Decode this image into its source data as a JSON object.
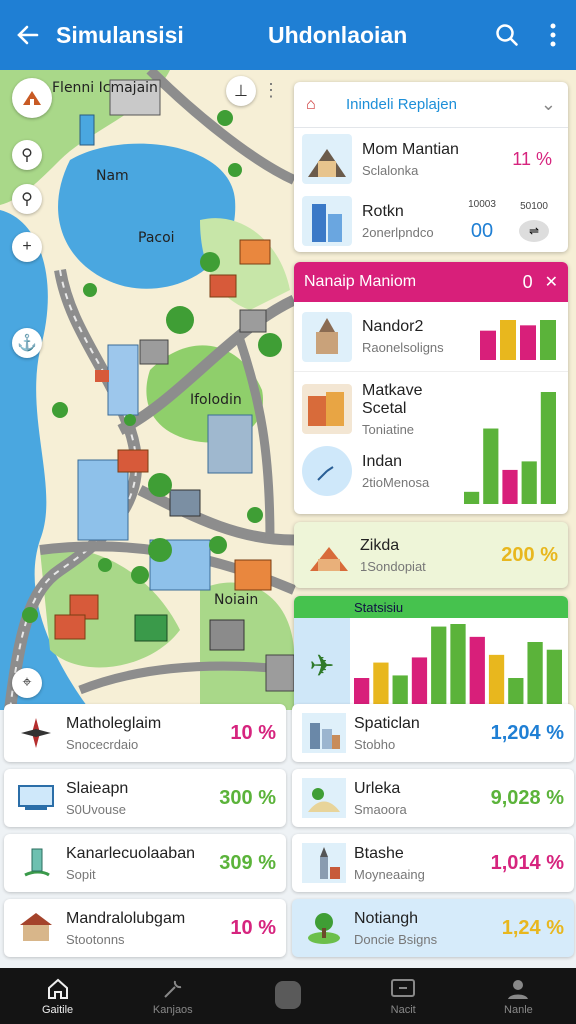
{
  "topbar": {
    "back_icon": "arrow-left-icon",
    "title_left": "Simulansisi",
    "title_center": "Uhdonlaoian",
    "search_icon": "search-icon",
    "more_icon": "more-vertical-icon"
  },
  "map": {
    "labels": {
      "top_left": "Flenni Icmajain",
      "lake_1": "Nam",
      "lake_2": "Pacoi",
      "park": "Ifolodin",
      "district": "Noiain"
    }
  },
  "panel": {
    "header_label": "Inindeli Replajen",
    "rows": [
      {
        "title": "Mom Mantian",
        "subtitle": "Sclalonka",
        "value": "11 %"
      },
      {
        "title": "Rotkn",
        "subtitle": "2onerlpndco",
        "col1": "10003",
        "col2": "50100",
        "value": "00"
      }
    ],
    "magenta_title": "Nanaip Maniom",
    "magenta_value": "0",
    "magenta_rows": [
      {
        "title": "Nandor2",
        "subtitle": "Raonelsoligns"
      },
      {
        "title": "Matkave Scetal",
        "subtitle": "Toniatine"
      },
      {
        "title": "Indan",
        "subtitle": "2tioMenosa"
      }
    ],
    "zikda": {
      "title": "Zikda",
      "subtitle": "1Sondopiat",
      "value": "200 %"
    },
    "stats_title": "Statsisiu",
    "chart1": [
      22,
      30,
      26,
      30
    ],
    "chart2": [
      10,
      62,
      28,
      35,
      92
    ],
    "chart3": [
      28,
      40,
      30,
      44,
      68,
      70,
      60,
      46,
      28,
      56,
      50
    ]
  },
  "list_left": [
    {
      "icon": "compass-icon",
      "title": "Matholeglaim",
      "subtitle": "Snocecrdaio",
      "value": "10 %",
      "color": "pink"
    },
    {
      "icon": "monitor-icon",
      "title": "Slaieapn",
      "subtitle": "S0Uvouse",
      "value": "300 %",
      "color": "green"
    },
    {
      "icon": "location-pin-icon",
      "title": "Kanarlecuolaaban",
      "subtitle": "Sopit",
      "value": "309 %",
      "color": "green"
    },
    {
      "icon": "temple-icon",
      "title": "Mandralolubgam",
      "subtitle": "Stootonns",
      "value": "10 %",
      "color": "pink"
    }
  ],
  "list_right": [
    {
      "icon": "city-icon",
      "title": "Spaticlan",
      "subtitle": "Stobho",
      "value": "1,204 %",
      "color": "blue"
    },
    {
      "icon": "hill-icon",
      "title": "Urleka",
      "subtitle": "Smaoora",
      "value": "9,028 %",
      "color": "green"
    },
    {
      "icon": "tower-icon",
      "title": "Btashe",
      "subtitle": "Moyneaaing",
      "value": "1,014 %",
      "color": "pink"
    },
    {
      "icon": "park-icon",
      "title": "Notiangh",
      "subtitle": "Doncie Bsigns",
      "value": "1,24 %",
      "color": "yellow"
    }
  ],
  "nav": [
    {
      "icon": "home-icon",
      "label": "Gaitile"
    },
    {
      "icon": "wrench-icon",
      "label": "Kanjaos"
    },
    {
      "icon": "center-button-icon",
      "label": ""
    },
    {
      "icon": "screen-icon",
      "label": "Nacit"
    },
    {
      "icon": "person-icon",
      "label": "Nanle"
    }
  ]
}
